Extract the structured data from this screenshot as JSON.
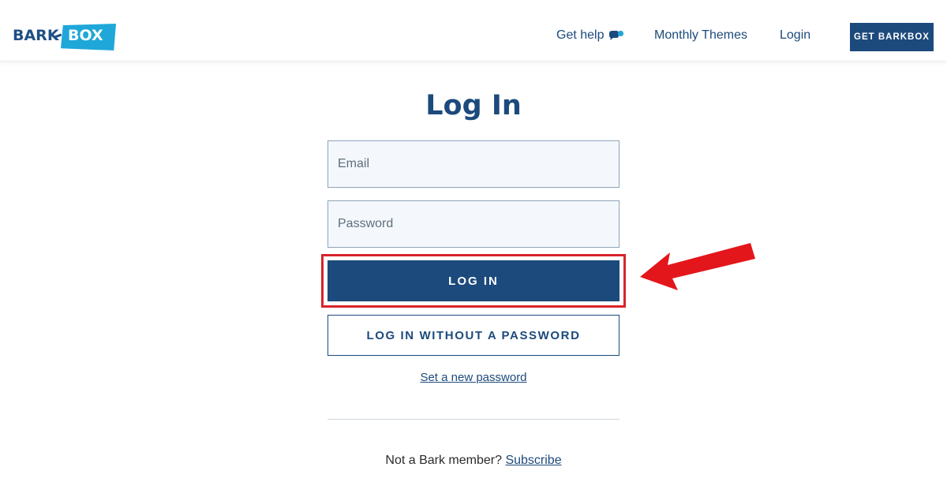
{
  "logo": {
    "part1": "BARK",
    "part2": "BOX"
  },
  "nav": {
    "get_help": "Get help",
    "monthly_themes": "Monthly Themes",
    "login": "Login",
    "cta": "GET BARKBOX"
  },
  "main": {
    "title": "Log In",
    "email_placeholder": "Email",
    "password_placeholder": "Password",
    "login_button": "LOG IN",
    "no_password_button": "LOG IN WITHOUT A PASSWORD",
    "set_password_link": "Set a new password",
    "footer_text": "Not a Bark member?",
    "subscribe_link": "Subscribe"
  },
  "icons": {
    "chat": "chat-bubble-icon",
    "arrow": "red-arrow-annotation"
  },
  "colors": {
    "brand_navy": "#1c4a7c",
    "brand_cyan": "#1ea7d8",
    "annotation_red": "#d9232a"
  }
}
